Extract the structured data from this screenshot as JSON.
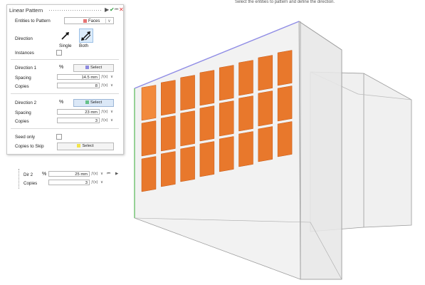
{
  "top_hint": "Select the entities to pattern and define the direction.",
  "panel": {
    "title": "Linear Pattern",
    "toolbar": {
      "run": "▶",
      "ok": "✔",
      "reset": "⏮",
      "close": "✕"
    },
    "entities_label": "Entities to Pattern",
    "entities_value": "Faces",
    "direction_label": "Direction",
    "single_label": "Single",
    "both_label": "Both",
    "instances_label": "Instances",
    "dir1_label": "Direction 1",
    "dir1_select": "Select",
    "spacing1_label": "Spacing",
    "spacing1_value": "14.5 mm",
    "copies1_label": "Copies",
    "copies1_value": "8",
    "dir2_label": "Direction 2",
    "dir2_select": "Select",
    "spacing2_label": "Spacing",
    "spacing2_value": "23 mm",
    "copies2_label": "Copies",
    "copies2_value": "3",
    "seed_label": "Seed only",
    "skip_label": "Copies to Skip",
    "skip_select": "Select",
    "fx": "ƒ(x)",
    "unit_arrow": "∨"
  },
  "mini_bar": {
    "dir_label": "Dir 2",
    "spacing_value": "25 mm",
    "copies_label": "Copies",
    "copies_value": "3",
    "fx": "ƒ(x)",
    "arrow": "∨",
    "prev": "⏮",
    "next": "▶"
  },
  "colors": {
    "swatch_faces": "#e57373",
    "swatch_dir1": "#8e8be0",
    "swatch_dir2": "#67c18a",
    "swatch_skip": "#f2e44a",
    "face_fill": "#e8782c",
    "face_selected": "#f28a3c",
    "edge_blue": "#8f8ce6",
    "edge_green": "#6dc06d"
  }
}
